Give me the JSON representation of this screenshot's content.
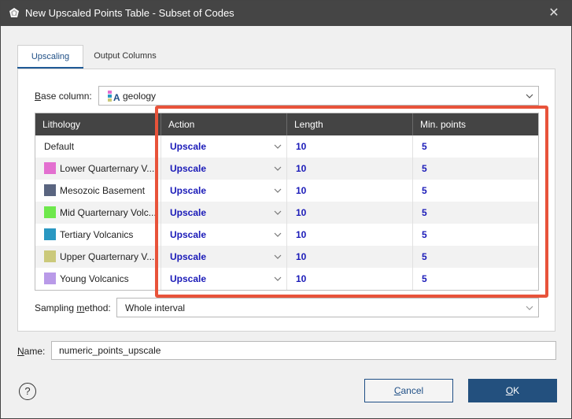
{
  "window": {
    "title": "New Upscaled Points Table - Subset of Codes",
    "close_glyph": "✕"
  },
  "tabs": [
    {
      "label": "Upscaling",
      "active": true
    },
    {
      "label": "Output Columns",
      "active": false
    }
  ],
  "base_column": {
    "label_underlined": "B",
    "label_rest": "ase column:",
    "value": "geology",
    "icon": "lithology-column-icon"
  },
  "grid": {
    "headers": [
      "Lithology",
      "Action",
      "Length",
      "Min. points"
    ],
    "rows": [
      {
        "lithology": "Default",
        "color": "",
        "action": "Upscale",
        "length": "10",
        "min_points": "5"
      },
      {
        "lithology": "Lower Quarternary V...",
        "color": "#e36fd0",
        "action": "Upscale",
        "length": "10",
        "min_points": "5"
      },
      {
        "lithology": "Mesozoic Basement",
        "color": "#5a6580",
        "action": "Upscale",
        "length": "10",
        "min_points": "5"
      },
      {
        "lithology": "Mid Quarternary Volc...",
        "color": "#6ee84c",
        "action": "Upscale",
        "length": "10",
        "min_points": "5"
      },
      {
        "lithology": "Tertiary Volcanics",
        "color": "#2a98c2",
        "action": "Upscale",
        "length": "10",
        "min_points": "5"
      },
      {
        "lithology": "Upper Quarternary V...",
        "color": "#cbc97a",
        "action": "Upscale",
        "length": "10",
        "min_points": "5"
      },
      {
        "lithology": "Young Volcanics",
        "color": "#b99ae8",
        "action": "Upscale",
        "length": "10",
        "min_points": "5"
      }
    ]
  },
  "sampling": {
    "label_pre": "Sampling ",
    "label_underlined": "m",
    "label_post": "ethod:",
    "value": "Whole interval"
  },
  "name": {
    "label_underlined": "N",
    "label_rest": "ame:",
    "value": "numeric_points_upscale"
  },
  "buttons": {
    "help": "?",
    "cancel_underlined": "C",
    "cancel_rest": "ancel",
    "ok_underlined": "O",
    "ok_rest": "K"
  },
  "colors": {
    "highlight": "#e8533a",
    "accent": "#23507e",
    "value_text": "#1a1ab8"
  }
}
